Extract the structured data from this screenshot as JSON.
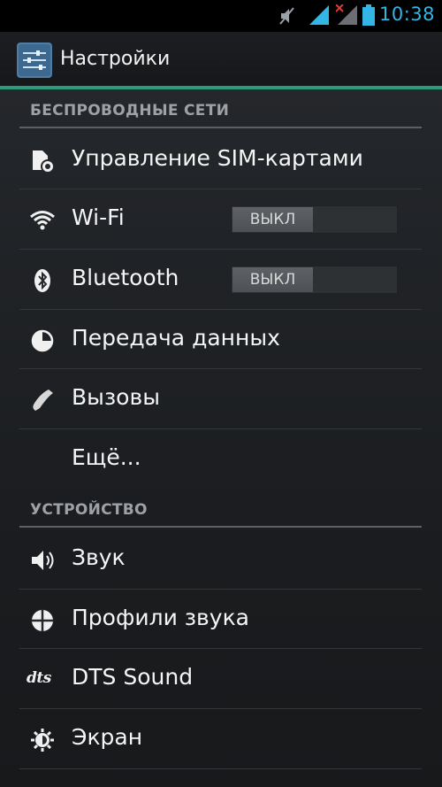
{
  "status_bar": {
    "time": "10:38",
    "icons": [
      "mute-icon",
      "signal-icon",
      "no-signal-icon",
      "battery-icon"
    ],
    "accent_color": "#33b5e5"
  },
  "action_bar": {
    "title": "Настройки",
    "icon": "settings-app-icon"
  },
  "colors": {
    "accent_line": "#2a9d7d",
    "section_header": "#9ea2a6"
  },
  "sections": [
    {
      "header": "БЕСПРОВОДНЫЕ СЕТИ",
      "items": [
        {
          "label": "Управление SIM-картами",
          "icon": "sim-icon"
        },
        {
          "label": "Wi-Fi",
          "icon": "wifi-icon",
          "toggle": "ВЫКЛ"
        },
        {
          "label": "Bluetooth",
          "icon": "bluetooth-icon",
          "toggle": "ВЫКЛ"
        },
        {
          "label": "Передача данных",
          "icon": "data-usage-icon"
        },
        {
          "label": "Вызовы",
          "icon": "phone-icon"
        },
        {
          "label": "Ещё...",
          "icon": ""
        }
      ]
    },
    {
      "header": "УСТРОЙСТВО",
      "items": [
        {
          "label": "Звук",
          "icon": "speaker-icon"
        },
        {
          "label": "Профили звука",
          "icon": "audio-profiles-icon"
        },
        {
          "label": "DTS Sound",
          "icon": "dts-icon",
          "icon_text": "dts"
        },
        {
          "label": "Экран",
          "icon": "brightness-icon"
        }
      ]
    }
  ]
}
